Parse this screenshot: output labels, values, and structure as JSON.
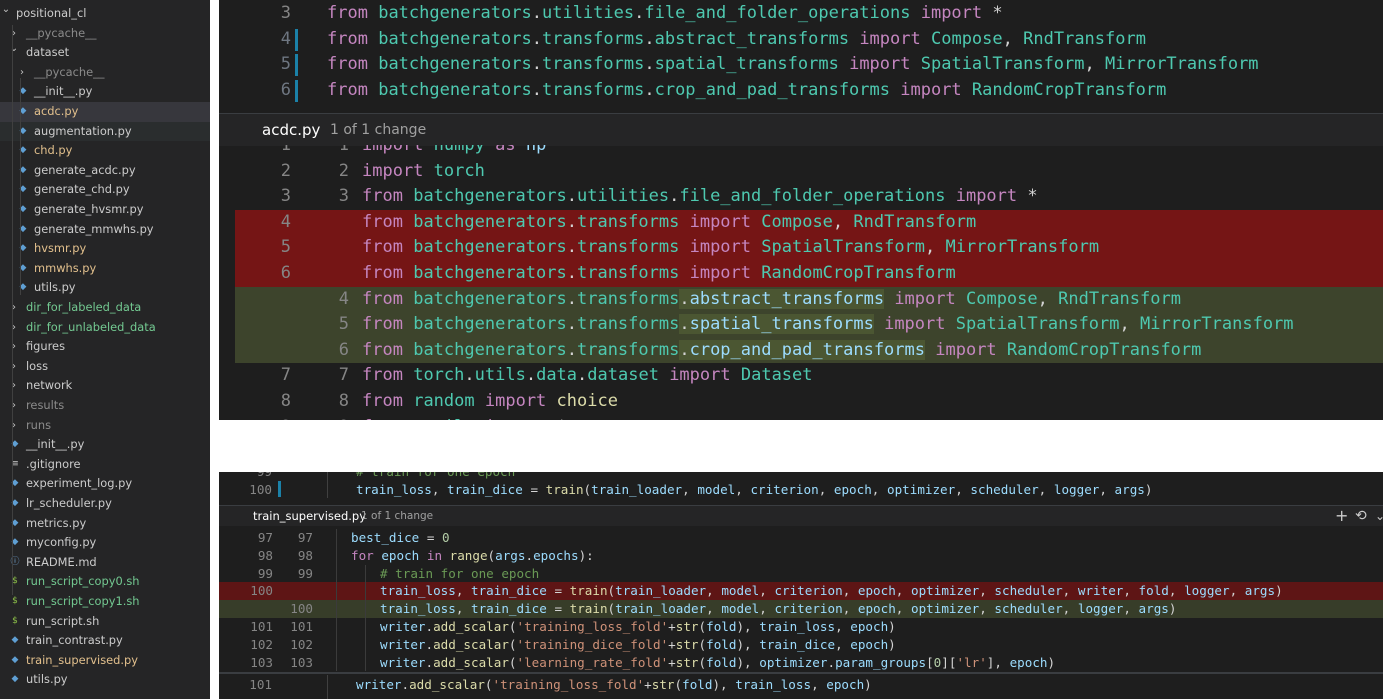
{
  "explorer": {
    "items": [
      {
        "label": "positional_cl",
        "depth": 0,
        "chev": "down",
        "icon": "",
        "color": "#ccc"
      },
      {
        "label": "__pycache__",
        "depth": 1,
        "chev": "right",
        "icon": "",
        "color": "#8b8b8b"
      },
      {
        "label": "dataset",
        "depth": 1,
        "chev": "down",
        "icon": "",
        "color": "#cccccc"
      },
      {
        "label": "__pycache__",
        "depth": 2,
        "chev": "right",
        "icon": "",
        "color": "#8b8b8b"
      },
      {
        "label": "__init__.py",
        "depth": 2,
        "chev": "",
        "icon": "py",
        "color": "#cccccc"
      },
      {
        "label": "acdc.py",
        "depth": 2,
        "chev": "",
        "icon": "py",
        "color": "#e2c08d"
      },
      {
        "label": "augmentation.py",
        "depth": 2,
        "chev": "",
        "icon": "py",
        "color": "#cccccc"
      },
      {
        "label": "chd.py",
        "depth": 2,
        "chev": "",
        "icon": "py",
        "color": "#e2c08d"
      },
      {
        "label": "generate_acdc.py",
        "depth": 2,
        "chev": "",
        "icon": "py",
        "color": "#cccccc"
      },
      {
        "label": "generate_chd.py",
        "depth": 2,
        "chev": "",
        "icon": "py",
        "color": "#cccccc"
      },
      {
        "label": "generate_hvsmr.py",
        "depth": 2,
        "chev": "",
        "icon": "py",
        "color": "#cccccc"
      },
      {
        "label": "generate_mmwhs.py",
        "depth": 2,
        "chev": "",
        "icon": "py",
        "color": "#cccccc"
      },
      {
        "label": "hvsmr.py",
        "depth": 2,
        "chev": "",
        "icon": "py",
        "color": "#e2c08d"
      },
      {
        "label": "mmwhs.py",
        "depth": 2,
        "chev": "",
        "icon": "py",
        "color": "#e2c08d"
      },
      {
        "label": "utils.py",
        "depth": 2,
        "chev": "",
        "icon": "py",
        "color": "#cccccc"
      },
      {
        "label": "dir_for_labeled_data",
        "depth": 1,
        "chev": "right",
        "icon": "",
        "color": "#73c991"
      },
      {
        "label": "dir_for_unlabeled_data",
        "depth": 1,
        "chev": "right",
        "icon": "",
        "color": "#73c991"
      },
      {
        "label": "figures",
        "depth": 1,
        "chev": "right",
        "icon": "",
        "color": "#cccccc"
      },
      {
        "label": "loss",
        "depth": 1,
        "chev": "right",
        "icon": "",
        "color": "#cccccc"
      },
      {
        "label": "network",
        "depth": 1,
        "chev": "right",
        "icon": "",
        "color": "#cccccc"
      },
      {
        "label": "results",
        "depth": 1,
        "chev": "right",
        "icon": "",
        "color": "#8b8b8b"
      },
      {
        "label": "runs",
        "depth": 1,
        "chev": "right",
        "icon": "",
        "color": "#8b8b8b"
      },
      {
        "label": "__init__.py",
        "depth": 1,
        "chev": "",
        "icon": "py",
        "color": "#cccccc"
      },
      {
        "label": ".gitignore",
        "depth": 1,
        "chev": "",
        "icon": "git",
        "color": "#cccccc"
      },
      {
        "label": "experiment_log.py",
        "depth": 1,
        "chev": "",
        "icon": "py",
        "color": "#cccccc"
      },
      {
        "label": "lr_scheduler.py",
        "depth": 1,
        "chev": "",
        "icon": "py",
        "color": "#cccccc"
      },
      {
        "label": "metrics.py",
        "depth": 1,
        "chev": "",
        "icon": "py",
        "color": "#cccccc"
      },
      {
        "label": "myconfig.py",
        "depth": 1,
        "chev": "",
        "icon": "py",
        "color": "#cccccc"
      },
      {
        "label": "README.md",
        "depth": 1,
        "chev": "",
        "icon": "info",
        "color": "#cccccc"
      },
      {
        "label": "run_script_copy0.sh",
        "depth": 1,
        "chev": "",
        "icon": "sh",
        "color": "#73c991"
      },
      {
        "label": "run_script_copy1.sh",
        "depth": 1,
        "chev": "",
        "icon": "sh",
        "color": "#73c991"
      },
      {
        "label": "run_script.sh",
        "depth": 1,
        "chev": "",
        "icon": "sh",
        "color": "#cccccc"
      },
      {
        "label": "train_contrast.py",
        "depth": 1,
        "chev": "",
        "icon": "py",
        "color": "#cccccc"
      },
      {
        "label": "train_supervised.py",
        "depth": 1,
        "chev": "",
        "icon": "py",
        "color": "#e2c08d"
      },
      {
        "label": "utils.py",
        "depth": 1,
        "chev": "",
        "icon": "py",
        "color": "#cccccc"
      }
    ]
  },
  "top_editor": {
    "lines": [
      {
        "n": "3",
        "code": "from batchgenerators.utilities.file_and_folder_operations import *"
      },
      {
        "n": "4",
        "code": "from batchgenerators.transforms.abstract_transforms import Compose, RndTransform"
      },
      {
        "n": "5",
        "code": "from batchgenerators.transforms.spatial_transforms import SpatialTransform, MirrorTransform"
      },
      {
        "n": "6",
        "code": "from batchgenerators.transforms.crop_and_pad_transforms import RandomCropTransform"
      }
    ]
  },
  "top_peek": {
    "file": "acdc.py",
    "info": "1 of 1 change",
    "lines": [
      {
        "o": "1",
        "m": "1",
        "code": "import numpy as np",
        "kind": "ctx"
      },
      {
        "o": "2",
        "m": "2",
        "code": "import torch",
        "kind": "ctx"
      },
      {
        "o": "3",
        "m": "3",
        "code": "from batchgenerators.utilities.file_and_folder_operations import *",
        "kind": "ctx"
      },
      {
        "o": "4",
        "m": "",
        "code": "from batchgenerators.transforms import Compose, RndTransform",
        "kind": "rm"
      },
      {
        "o": "5",
        "m": "",
        "code": "from batchgenerators.transforms import SpatialTransform, MirrorTransform",
        "kind": "rm"
      },
      {
        "o": "6",
        "m": "",
        "code": "from batchgenerators.transforms import RandomCropTransform",
        "kind": "rm"
      },
      {
        "o": "",
        "m": "4",
        "code": "from batchgenerators.transforms.abstract_transforms import Compose, RndTransform",
        "kind": "add"
      },
      {
        "o": "",
        "m": "5",
        "code": "from batchgenerators.transforms.spatial_transforms import SpatialTransform, MirrorTransform",
        "kind": "add"
      },
      {
        "o": "",
        "m": "6",
        "code": "from batchgenerators.transforms.crop_and_pad_transforms import RandomCropTransform",
        "kind": "add"
      },
      {
        "o": "7",
        "m": "7",
        "code": "from torch.utils.data.dataset import Dataset",
        "kind": "ctx"
      },
      {
        "o": "8",
        "m": "8",
        "code": "from random import choice",
        "kind": "ctx"
      },
      {
        "o": "9",
        "m": "9",
        "code": "from .utils import *",
        "kind": "ctx"
      }
    ]
  },
  "bottom_editor": {
    "above": [
      {
        "n": "99",
        "code": "# train for one epoch"
      },
      {
        "n": "100",
        "code": "train_loss, train_dice = train(train_loader, model, criterion, epoch, optimizer, scheduler, logger, args)"
      }
    ],
    "below": [
      {
        "n": "101",
        "code": "writer.add_scalar('training_loss_fold'+str(fold), train_loss, epoch)"
      }
    ]
  },
  "bottom_peek": {
    "file": "train_supervised.py",
    "info": "1 of 1 change",
    "actions": {
      "add": "+",
      "revert": "⟲",
      "more": "⌄"
    },
    "lines": [
      {
        "o": "97",
        "m": "97",
        "code": "best_dice = 0",
        "kind": "ctx",
        "indent": 1
      },
      {
        "o": "98",
        "m": "98",
        "code": "for epoch in range(args.epochs):",
        "kind": "ctx",
        "indent": 1
      },
      {
        "o": "99",
        "m": "99",
        "code": "# train for one epoch",
        "kind": "ctx",
        "indent": 2
      },
      {
        "o": "100",
        "m": "",
        "code": "train_loss, train_dice = train(train_loader, model, criterion, epoch, optimizer, scheduler, writer, fold, logger, args)",
        "kind": "rm",
        "indent": 2
      },
      {
        "o": "",
        "m": "100",
        "code": "train_loss, train_dice = train(train_loader, model, criterion, epoch, optimizer, scheduler, logger, args)",
        "kind": "add",
        "indent": 2
      },
      {
        "o": "101",
        "m": "101",
        "code": "writer.add_scalar('training_loss_fold'+str(fold), train_loss, epoch)",
        "kind": "ctx",
        "indent": 2
      },
      {
        "o": "102",
        "m": "102",
        "code": "writer.add_scalar('training_dice_fold'+str(fold), train_dice, epoch)",
        "kind": "ctx",
        "indent": 2
      },
      {
        "o": "103",
        "m": "103",
        "code": "writer.add_scalar('learning_rate_fold'+str(fold), optimizer.param_groups[0]['lr'], epoch)",
        "kind": "ctx",
        "indent": 2
      }
    ]
  },
  "colors": {
    "removed": "#6f1313",
    "added": "#373d29",
    "editor_bg": "#1e1e1e",
    "sidebar_bg": "#252526"
  }
}
